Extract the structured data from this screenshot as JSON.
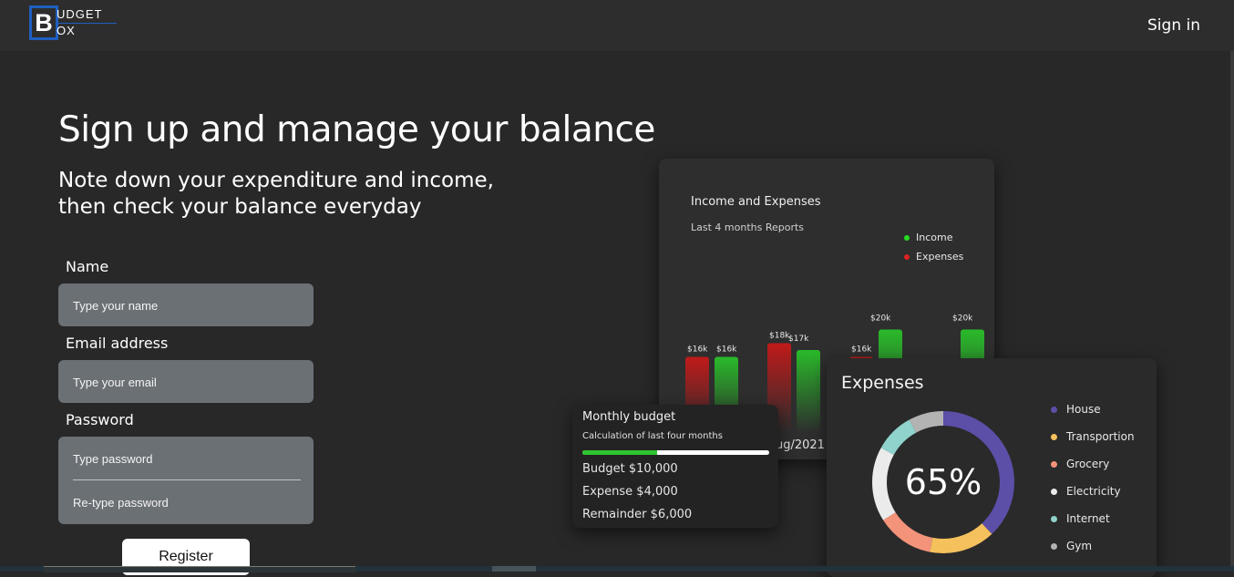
{
  "header": {
    "logo_letter": "B",
    "logo_top": "UDGET",
    "logo_bottom": "OX",
    "signin_label": "Sign in"
  },
  "hero": {
    "title": "Sign up and manage your balance",
    "subtitle_line1": "Note down your expenditure and income,",
    "subtitle_line2": "then check your balance everyday"
  },
  "form": {
    "name_label": "Name",
    "name_placeholder": "Type your name",
    "email_label": "Email address",
    "email_placeholder": "Type your email",
    "password_label": "Password",
    "password_placeholder": "Type password",
    "retype_placeholder": "Re-type password",
    "register_label": "Register"
  },
  "income_card": {
    "title": "Income and Expenses",
    "subtitle": "Last 4 months Reports",
    "legend_income": "Income",
    "legend_expenses": "Expenses",
    "x_label_fragment": "ug/2021",
    "income_color": "#22dd22",
    "expense_color": "#dd2222"
  },
  "chart_data": {
    "type": "bar",
    "title": "Income and Expenses",
    "subtitle": "Last 4 months Reports",
    "series": [
      {
        "name": "Expenses",
        "values": [
          16,
          18,
          16,
          null
        ],
        "labels": [
          "$16k",
          "$18k",
          "$16k",
          ""
        ]
      },
      {
        "name": "Income",
        "values": [
          16,
          17,
          20,
          20
        ],
        "labels": [
          "$16k",
          "$17k",
          "$20k",
          "$20k"
        ]
      }
    ]
  },
  "monthly_budget": {
    "title": "Monthly budget",
    "subtitle": "Calculation of last four months",
    "progress_fraction": 0.4,
    "budget_line": "Budget  $10,000",
    "expense_line": "Expense $4,000",
    "remainder_line": "Remainder $6,000"
  },
  "expenses_card": {
    "title": "Expenses",
    "percent": "65%",
    "categories": [
      {
        "name": "House",
        "color": "#5b4fa8",
        "share": 0.38
      },
      {
        "name": "Transportion",
        "color": "#f5c15c",
        "share": 0.15
      },
      {
        "name": "Grocery",
        "color": "#f2937a",
        "share": 0.13
      },
      {
        "name": "Electricity",
        "color": "#ebebeb",
        "share": 0.17
      },
      {
        "name": "Internet",
        "color": "#8fd3cc",
        "share": 0.09
      },
      {
        "name": "Gym",
        "color": "#b3b3b3",
        "share": 0.08
      }
    ]
  }
}
